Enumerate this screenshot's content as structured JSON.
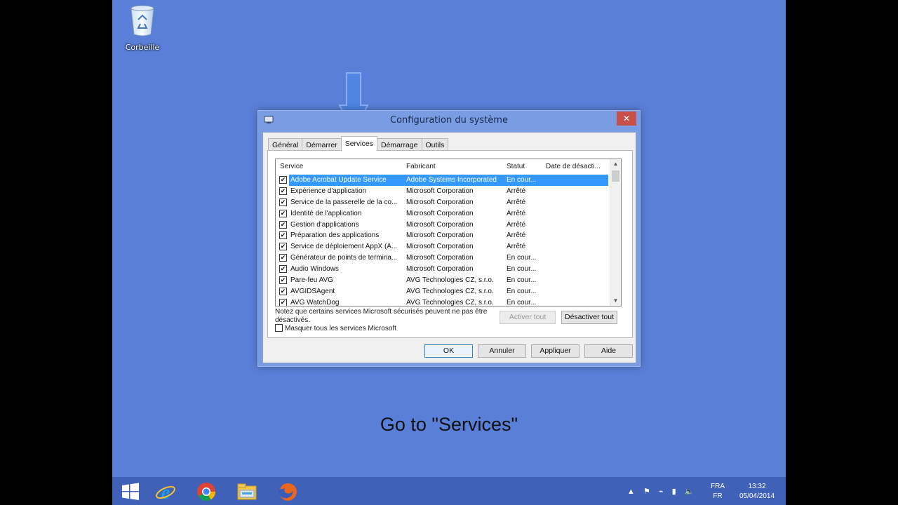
{
  "desktop": {
    "background_color": "#5a7fd8",
    "recycle_bin_label": "Corbeille"
  },
  "dialog": {
    "title": "Configuration du système",
    "close_label": "✕",
    "tabs": [
      {
        "label": "Général",
        "active": false
      },
      {
        "label": "Démarrer",
        "active": false
      },
      {
        "label": "Services",
        "active": true
      },
      {
        "label": "Démarrage",
        "active": false
      },
      {
        "label": "Outils",
        "active": false
      }
    ],
    "columns": {
      "service": "Service",
      "manufacturer": "Fabricant",
      "status": "Statut",
      "date_disabled": "Date de désacti..."
    },
    "rows": [
      {
        "service": "Adobe Acrobat Update Service",
        "manufacturer": "Adobe Systems Incorporated",
        "status": "En cour...",
        "checked": true,
        "selected": true
      },
      {
        "service": "Expérience d'application",
        "manufacturer": "Microsoft Corporation",
        "status": "Arrêté",
        "checked": true
      },
      {
        "service": "Service de la passerelle de la co...",
        "manufacturer": "Microsoft Corporation",
        "status": "Arrêté",
        "checked": true
      },
      {
        "service": "Identité de l'application",
        "manufacturer": "Microsoft Corporation",
        "status": "Arrêté",
        "checked": true
      },
      {
        "service": "Gestion d'applications",
        "manufacturer": "Microsoft Corporation",
        "status": "Arrêté",
        "checked": true
      },
      {
        "service": "Préparation des applications",
        "manufacturer": "Microsoft Corporation",
        "status": "Arrêté",
        "checked": true
      },
      {
        "service": "Service de déploiement AppX (A...",
        "manufacturer": "Microsoft Corporation",
        "status": "Arrêté",
        "checked": true
      },
      {
        "service": "Générateur de points de termina...",
        "manufacturer": "Microsoft Corporation",
        "status": "En cour...",
        "checked": true
      },
      {
        "service": "Audio Windows",
        "manufacturer": "Microsoft Corporation",
        "status": "En cour...",
        "checked": true
      },
      {
        "service": "Pare-feu AVG",
        "manufacturer": "AVG Technologies CZ, s.r.o.",
        "status": "En cour...",
        "checked": true
      },
      {
        "service": "AVGIDSAgent",
        "manufacturer": "AVG Technologies CZ, s.r.o.",
        "status": "En cour...",
        "checked": true
      },
      {
        "service": "AVG WatchDog",
        "manufacturer": "AVG Technologies CZ, s.r.o.",
        "status": "En cour...",
        "checked": true
      }
    ],
    "note": "Notez que certains services Microsoft sécurisés peuvent ne pas être désactivés.",
    "enable_all_label": "Activer tout",
    "disable_all_label": "Désactiver tout",
    "hide_ms_label": "Masquer tous les services Microsoft",
    "ok_label": "OK",
    "cancel_label": "Annuler",
    "apply_label": "Appliquer",
    "help_label": "Aide"
  },
  "caption": "Go to \"Services\"",
  "taskbar": {
    "apps": [
      "start-icon",
      "internet-explorer-icon",
      "chrome-icon",
      "file-explorer-icon",
      "firefox-icon"
    ],
    "language_top": "FRA",
    "language_bottom": "FR",
    "time": "13:32",
    "date": "05/04/2014"
  }
}
